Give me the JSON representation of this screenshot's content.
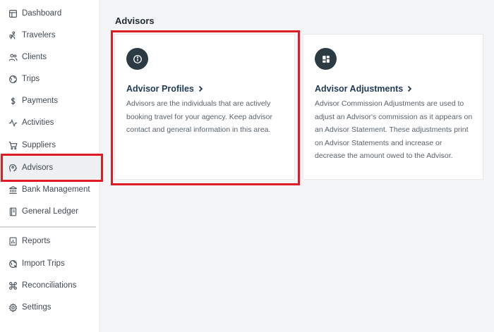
{
  "sidebar": {
    "items": [
      {
        "label": "Dashboard",
        "icon": "dashboard-icon"
      },
      {
        "label": "Travelers",
        "icon": "traveler-icon"
      },
      {
        "label": "Clients",
        "icon": "clients-icon"
      },
      {
        "label": "Trips",
        "icon": "globe-icon"
      },
      {
        "label": "Payments",
        "icon": "dollar-icon"
      },
      {
        "label": "Activities",
        "icon": "activity-icon"
      },
      {
        "label": "Suppliers",
        "icon": "cart-icon"
      },
      {
        "label": "Advisors",
        "icon": "advisor-icon"
      },
      {
        "label": "Bank Management",
        "icon": "bank-icon"
      },
      {
        "label": "General Ledger",
        "icon": "ledger-icon"
      }
    ],
    "secondary_items": [
      {
        "label": "Reports",
        "icon": "reports-icon"
      },
      {
        "label": "Import Trips",
        "icon": "import-icon"
      },
      {
        "label": "Reconciliations",
        "icon": "command-icon"
      },
      {
        "label": "Settings",
        "icon": "gear-icon"
      }
    ],
    "active": "Advisors"
  },
  "main": {
    "title": "Advisors",
    "cards": [
      {
        "title": "Advisor Profiles",
        "icon": "info-icon",
        "description": "Advisors are the individuals that are actively booking travel for your agency. Keep advisor contact and general information in this area."
      },
      {
        "title": "Advisor Adjustments",
        "icon": "grid-icon",
        "description": "Advisor Commission Adjustments are used to adjust an Advisor's commission as it appears on an Advisor Statement. These adjustments print on Advisor Statements and increase or decrease the amount owed to the Advisor."
      }
    ]
  },
  "colors": {
    "highlight": "#e01b24",
    "icon_circle": "#2c3a44",
    "card_title": "#1f3a55"
  }
}
